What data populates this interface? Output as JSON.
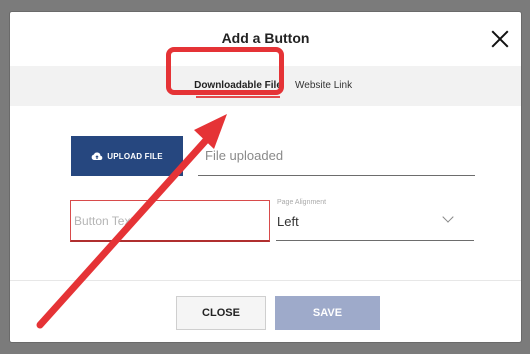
{
  "modal": {
    "title": "Add a Button"
  },
  "tabs": [
    {
      "label": "Downloadable File",
      "active": true
    },
    {
      "label": "Website Link",
      "active": false
    }
  ],
  "upload": {
    "button_label": "UPLOAD FILE",
    "status_text": "File uploaded"
  },
  "button_text_field": {
    "placeholder": "Button Text",
    "value": ""
  },
  "page_alignment": {
    "label": "Page Alignment",
    "selected": "Left"
  },
  "footer": {
    "close_label": "CLOSE",
    "save_label": "SAVE"
  },
  "colors": {
    "accent_red": "#e53336",
    "primary_blue": "#26477f",
    "save_disabled": "#9eaaca"
  },
  "icons": {
    "close": "close-icon",
    "upload": "cloud-upload-icon",
    "dropdown": "chevron-down-icon"
  }
}
